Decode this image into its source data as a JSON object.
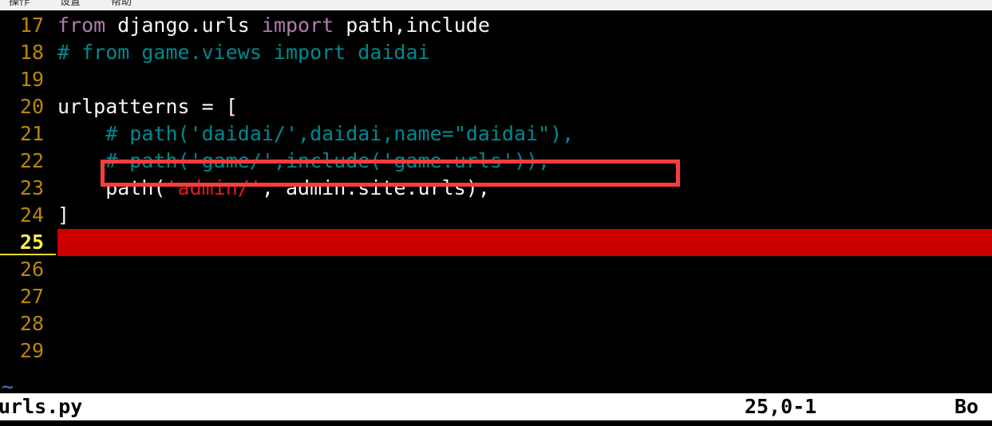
{
  "window": {
    "menubar": {
      "items": [
        {
          "label": "操作"
        },
        {
          "label": "设置"
        },
        {
          "label": "帮助"
        }
      ]
    }
  },
  "editor": {
    "filler_char": "~",
    "lines": [
      {
        "number": "17",
        "current": false,
        "tokens": [
          {
            "text": "from ",
            "cls": "tok-kw"
          },
          {
            "text": "django.urls ",
            "cls": "tok-plain"
          },
          {
            "text": "import ",
            "cls": "tok-kw"
          },
          {
            "text": "path,include",
            "cls": "tok-plain"
          }
        ]
      },
      {
        "number": "18",
        "current": false,
        "tokens": [
          {
            "text": "# from game.views import daidai",
            "cls": "tok-comment"
          }
        ]
      },
      {
        "number": "19",
        "current": false,
        "tokens": []
      },
      {
        "number": "20",
        "current": false,
        "tokens": [
          {
            "text": "urlpatterns = [",
            "cls": "tok-plain"
          }
        ]
      },
      {
        "number": "21",
        "current": false,
        "tokens": [
          {
            "text": "    # path('daidai/',daidai,name=\"daidai\"),",
            "cls": "tok-comment"
          }
        ]
      },
      {
        "number": "22",
        "current": false,
        "tokens": [
          {
            "text": "    # path('game/',include('game.urls')),",
            "cls": "tok-comment"
          }
        ]
      },
      {
        "number": "23",
        "current": false,
        "tokens": [
          {
            "text": "    path(",
            "cls": "tok-plain"
          },
          {
            "text": "'admin/'",
            "cls": "tok-str"
          },
          {
            "text": ", admin.site.urls),",
            "cls": "tok-plain"
          }
        ]
      },
      {
        "number": "24",
        "current": false,
        "tokens": [
          {
            "text": "]",
            "cls": "tok-plain"
          }
        ]
      },
      {
        "number": "25",
        "current": true,
        "tokens": []
      },
      {
        "number": "26",
        "current": false,
        "tokens": []
      },
      {
        "number": "27",
        "current": false,
        "tokens": []
      },
      {
        "number": "28",
        "current": false,
        "tokens": []
      },
      {
        "number": "29",
        "current": false,
        "tokens": []
      }
    ]
  },
  "annotation": {
    "color": "#f93d3d",
    "target_line": "22",
    "target_text": "# path('game/',include('game.urls')),"
  },
  "cursor_highlight": {
    "color": "#cc0000",
    "line": "25"
  },
  "statusline": {
    "filename": "urls.py",
    "position": "25,0-1",
    "location": "Bo"
  }
}
